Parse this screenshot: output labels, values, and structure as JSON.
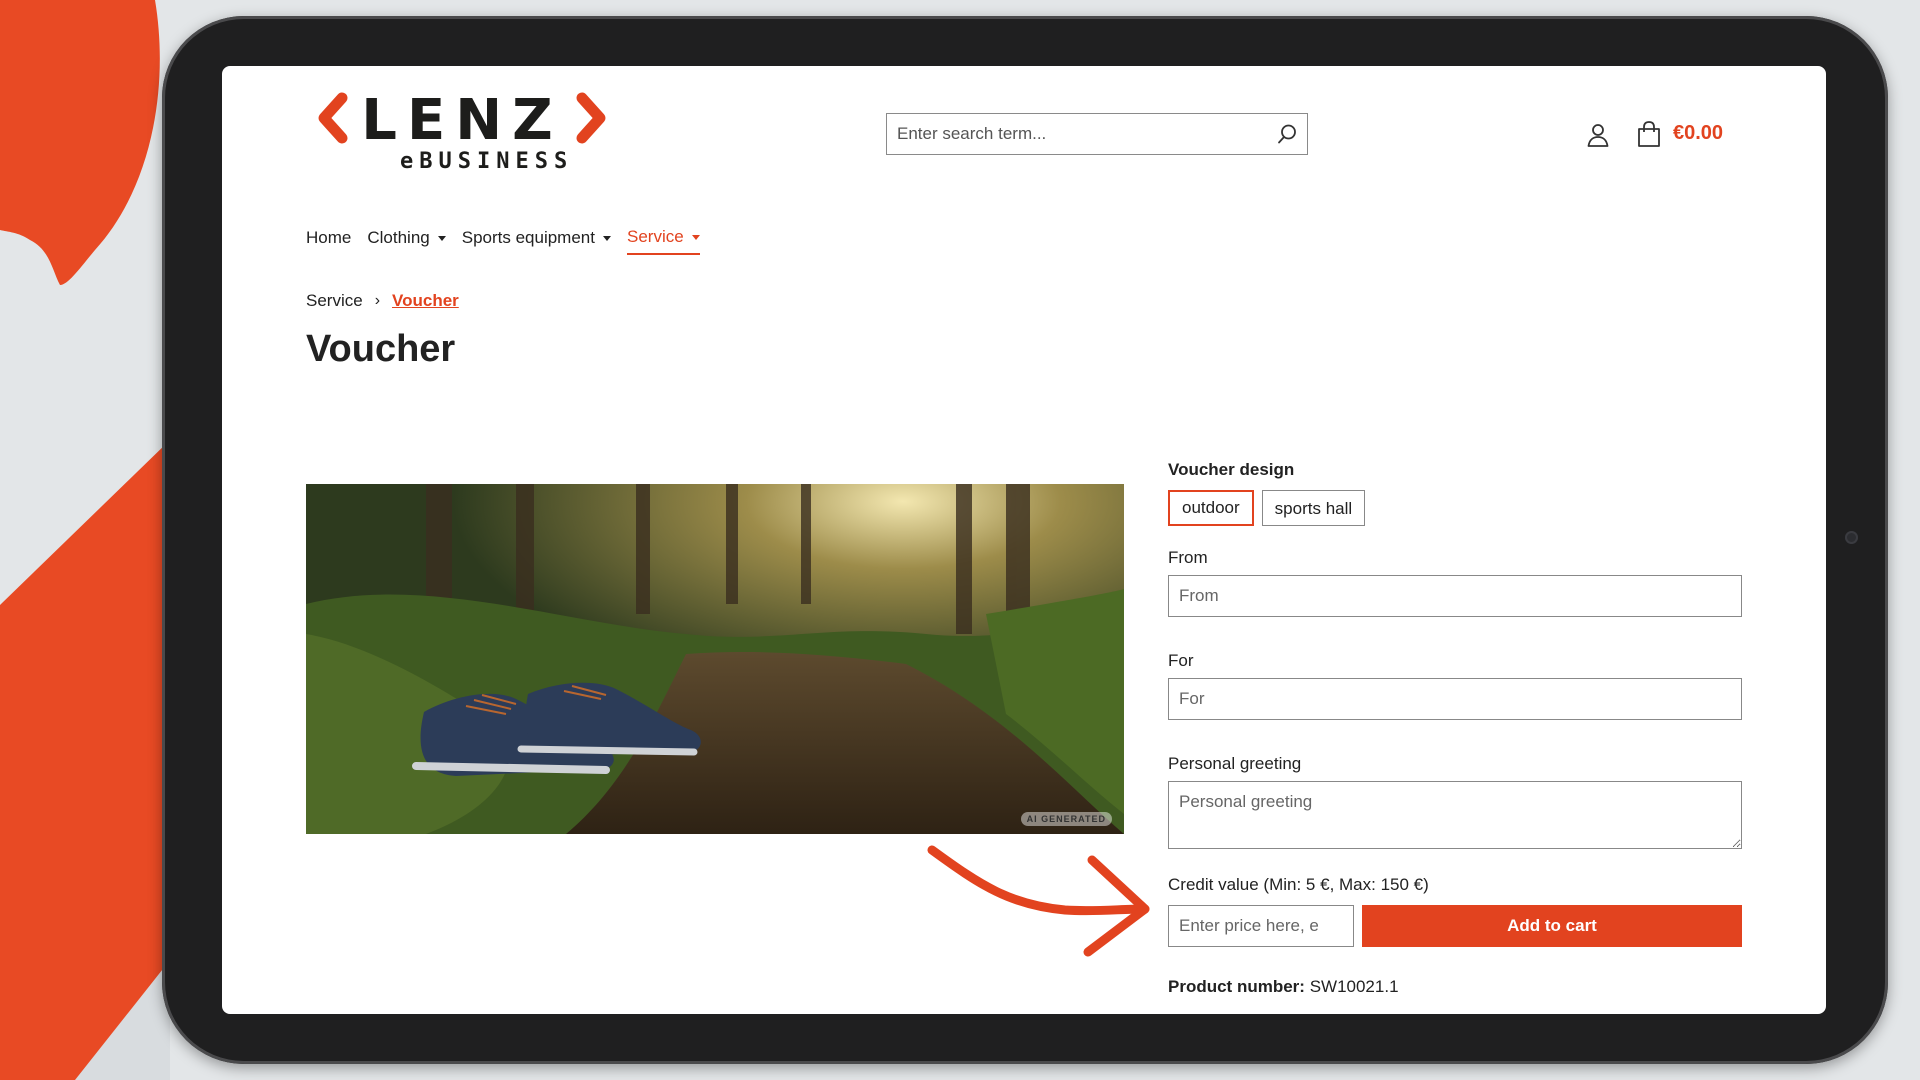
{
  "colors": {
    "accent": "#e2431f",
    "text": "#222222",
    "background": "#ffffff"
  },
  "header": {
    "logo": {
      "text": "LENZ",
      "subtitle": "eBUSINESS"
    },
    "search": {
      "placeholder": "Enter search term..."
    },
    "cart": {
      "total": "€0.00"
    }
  },
  "nav": {
    "items": [
      {
        "label": "Home",
        "has_dropdown": false,
        "active": false
      },
      {
        "label": "Clothing",
        "has_dropdown": true,
        "active": false
      },
      {
        "label": "Sports equipment",
        "has_dropdown": true,
        "active": false
      },
      {
        "label": "Service",
        "has_dropdown": true,
        "active": true
      }
    ]
  },
  "breadcrumb": {
    "parent": "Service",
    "separator": "›",
    "current": "Voucher"
  },
  "page": {
    "title": "Voucher"
  },
  "image": {
    "badge": "AI GENERATED"
  },
  "form": {
    "design_label": "Voucher design",
    "design_options": [
      {
        "label": "outdoor",
        "selected": true
      },
      {
        "label": "sports hall",
        "selected": false
      }
    ],
    "from": {
      "label": "From",
      "placeholder": "From"
    },
    "for": {
      "label": "For",
      "placeholder": "For"
    },
    "greeting": {
      "label": "Personal greeting",
      "placeholder": "Personal greeting"
    },
    "credit": {
      "label": "Credit value (Min: 5 €, Max: 150 €)",
      "placeholder": "Enter price here, e"
    },
    "add_to_cart": "Add to cart",
    "product_number_label": "Product number:",
    "product_number_value": "SW10021.1"
  }
}
